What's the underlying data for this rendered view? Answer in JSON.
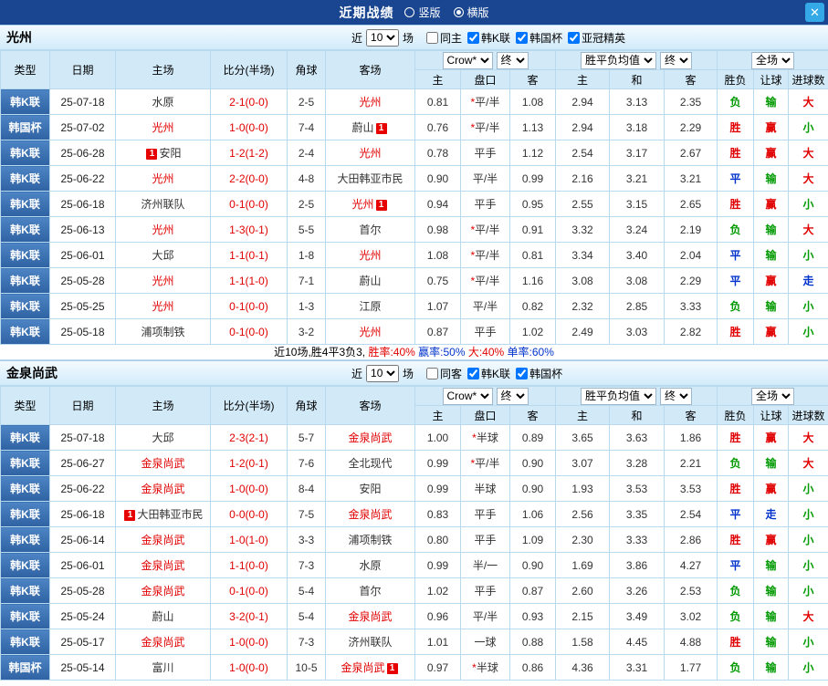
{
  "titlebar": {
    "title": "近期战绩",
    "view_options": [
      {
        "label": "竖版",
        "selected": false
      },
      {
        "label": "横版",
        "selected": true
      }
    ],
    "close_glyph": "✕"
  },
  "table_headers": {
    "type": "类型",
    "date": "日期",
    "home": "主场",
    "score": "比分(半场)",
    "corner": "角球",
    "away": "客场",
    "odds_source": "Crow*",
    "odds_final": "终",
    "europe_source": "胜平负均值",
    "europe_final": "终",
    "scope": "全场",
    "col_home": "主",
    "col_handicap": "盘口",
    "col_away": "客",
    "col_eu_home": "主",
    "col_eu_draw": "和",
    "col_eu_away": "客",
    "col_wdl": "胜负",
    "col_hc_result": "让球",
    "col_goals": "进球数"
  },
  "sections": [
    {
      "team": "光州",
      "filters": {
        "near_label": "近",
        "count": "10",
        "games_label": "场",
        "checkboxes": [
          {
            "label": "同主",
            "checked": false
          },
          {
            "label": "韩K联",
            "checked": true
          },
          {
            "label": "韩国杯",
            "checked": true
          },
          {
            "label": "亚冠精英",
            "checked": true
          }
        ]
      },
      "rows": [
        {
          "type": "韩K联",
          "date": "25-07-18",
          "home": {
            "name": "水原"
          },
          "score": "2-1(0-0)",
          "corner": "2-5",
          "away": {
            "name": "光州",
            "hl": true
          },
          "o1": "0.81",
          "hc": "*平/半",
          "o2": "1.08",
          "e1": "2.94",
          "e2": "3.13",
          "e3": "2.35",
          "r1": "负",
          "r2": "输",
          "r3": "大"
        },
        {
          "type": "韩国杯",
          "date": "25-07-02",
          "home": {
            "name": "光州",
            "hl": true
          },
          "score": "1-0(0-0)",
          "corner": "7-4",
          "away": {
            "name": "蔚山",
            "badge": "1",
            "badge_pos": "after"
          },
          "o1": "0.76",
          "hc": "*平/半",
          "o2": "1.13",
          "e1": "2.94",
          "e2": "3.18",
          "e3": "2.29",
          "r1": "胜",
          "r2": "赢",
          "r3": "小"
        },
        {
          "type": "韩K联",
          "date": "25-06-28",
          "home": {
            "name": "安阳",
            "badge": "1",
            "badge_pos": "before"
          },
          "score": "1-2(1-2)",
          "corner": "2-4",
          "away": {
            "name": "光州",
            "hl": true
          },
          "o1": "0.78",
          "hc": "平手",
          "o2": "1.12",
          "e1": "2.54",
          "e2": "3.17",
          "e3": "2.67",
          "r1": "胜",
          "r2": "赢",
          "r3": "大"
        },
        {
          "type": "韩K联",
          "date": "25-06-22",
          "home": {
            "name": "光州",
            "hl": true
          },
          "score": "2-2(0-0)",
          "corner": "4-8",
          "away": {
            "name": "大田韩亚市民"
          },
          "o1": "0.90",
          "hc": "平/半",
          "o2": "0.99",
          "e1": "2.16",
          "e2": "3.21",
          "e3": "3.21",
          "r1": "平",
          "r2": "输",
          "r3": "大"
        },
        {
          "type": "韩K联",
          "date": "25-06-18",
          "home": {
            "name": "济州联队"
          },
          "score": "0-1(0-0)",
          "corner": "2-5",
          "away": {
            "name": "光州",
            "hl": true,
            "badge": "1",
            "badge_pos": "after"
          },
          "o1": "0.94",
          "hc": "平手",
          "o2": "0.95",
          "e1": "2.55",
          "e2": "3.15",
          "e3": "2.65",
          "r1": "胜",
          "r2": "赢",
          "r3": "小"
        },
        {
          "type": "韩K联",
          "date": "25-06-13",
          "home": {
            "name": "光州",
            "hl": true
          },
          "score": "1-3(0-1)",
          "corner": "5-5",
          "away": {
            "name": "首尔"
          },
          "o1": "0.98",
          "hc": "*平/半",
          "o2": "0.91",
          "e1": "3.32",
          "e2": "3.24",
          "e3": "2.19",
          "r1": "负",
          "r2": "输",
          "r3": "大"
        },
        {
          "type": "韩K联",
          "date": "25-06-01",
          "home": {
            "name": "大邱"
          },
          "score": "1-1(0-1)",
          "corner": "1-8",
          "away": {
            "name": "光州",
            "hl": true
          },
          "o1": "1.08",
          "hc": "*平/半",
          "o2": "0.81",
          "e1": "3.34",
          "e2": "3.40",
          "e3": "2.04",
          "r1": "平",
          "r2": "输",
          "r3": "小"
        },
        {
          "type": "韩K联",
          "date": "25-05-28",
          "home": {
            "name": "光州",
            "hl": true
          },
          "score": "1-1(1-0)",
          "corner": "7-1",
          "away": {
            "name": "蔚山"
          },
          "o1": "0.75",
          "hc": "*平/半",
          "o2": "1.16",
          "e1": "3.08",
          "e2": "3.08",
          "e3": "2.29",
          "r1": "平",
          "r2": "赢",
          "r3": "走"
        },
        {
          "type": "韩K联",
          "date": "25-05-25",
          "home": {
            "name": "光州",
            "hl": true
          },
          "score": "0-1(0-0)",
          "corner": "1-3",
          "away": {
            "name": "江原"
          },
          "o1": "1.07",
          "hc": "平/半",
          "o2": "0.82",
          "e1": "2.32",
          "e2": "2.85",
          "e3": "3.33",
          "r1": "负",
          "r2": "输",
          "r3": "小"
        },
        {
          "type": "韩K联",
          "date": "25-05-18",
          "home": {
            "name": "浦项制铁"
          },
          "score": "0-1(0-0)",
          "corner": "3-2",
          "away": {
            "name": "光州",
            "hl": true
          },
          "o1": "0.87",
          "hc": "平手",
          "o2": "1.02",
          "e1": "2.49",
          "e2": "3.03",
          "e3": "2.82",
          "r1": "胜",
          "r2": "赢",
          "r3": "小"
        }
      ],
      "summary": [
        {
          "text": "近10场,胜4平3负3, ",
          "color": "black"
        },
        {
          "text": "胜率:40%",
          "color": "red"
        },
        {
          "text": " 赢率:50%",
          "color": "blue"
        },
        {
          "text": " 大:40%",
          "color": "red"
        },
        {
          "text": " 单率:60%",
          "color": "blue"
        }
      ]
    },
    {
      "team": "金泉尚武",
      "filters": {
        "near_label": "近",
        "count": "10",
        "games_label": "场",
        "checkboxes": [
          {
            "label": "同客",
            "checked": false
          },
          {
            "label": "韩K联",
            "checked": true
          },
          {
            "label": "韩国杯",
            "checked": true
          }
        ]
      },
      "rows": [
        {
          "type": "韩K联",
          "date": "25-07-18",
          "home": {
            "name": "大邱"
          },
          "score": "2-3(2-1)",
          "corner": "5-7",
          "away": {
            "name": "金泉尚武",
            "hl": true
          },
          "o1": "1.00",
          "hc": "*半球",
          "o2": "0.89",
          "e1": "3.65",
          "e2": "3.63",
          "e3": "1.86",
          "r1": "胜",
          "r2": "赢",
          "r3": "大"
        },
        {
          "type": "韩K联",
          "date": "25-06-27",
          "home": {
            "name": "金泉尚武",
            "hl": true
          },
          "score": "1-2(0-1)",
          "corner": "7-6",
          "away": {
            "name": "全北现代"
          },
          "o1": "0.99",
          "hc": "*平/半",
          "o2": "0.90",
          "e1": "3.07",
          "e2": "3.28",
          "e3": "2.21",
          "r1": "负",
          "r2": "输",
          "r3": "大"
        },
        {
          "type": "韩K联",
          "date": "25-06-22",
          "home": {
            "name": "金泉尚武",
            "hl": true
          },
          "score": "1-0(0-0)",
          "corner": "8-4",
          "away": {
            "name": "安阳"
          },
          "o1": "0.99",
          "hc": "半球",
          "o2": "0.90",
          "e1": "1.93",
          "e2": "3.53",
          "e3": "3.53",
          "r1": "胜",
          "r2": "赢",
          "r3": "小"
        },
        {
          "type": "韩K联",
          "date": "25-06-18",
          "home": {
            "name": "大田韩亚市民",
            "badge": "1",
            "badge_pos": "before"
          },
          "score": "0-0(0-0)",
          "corner": "7-5",
          "away": {
            "name": "金泉尚武",
            "hl": true
          },
          "o1": "0.83",
          "hc": "平手",
          "o2": "1.06",
          "e1": "2.56",
          "e2": "3.35",
          "e3": "2.54",
          "r1": "平",
          "r2": "走",
          "r3": "小"
        },
        {
          "type": "韩K联",
          "date": "25-06-14",
          "home": {
            "name": "金泉尚武",
            "hl": true
          },
          "score": "1-0(1-0)",
          "corner": "3-3",
          "away": {
            "name": "浦项制铁"
          },
          "o1": "0.80",
          "hc": "平手",
          "o2": "1.09",
          "e1": "2.30",
          "e2": "3.33",
          "e3": "2.86",
          "r1": "胜",
          "r2": "赢",
          "r3": "小"
        },
        {
          "type": "韩K联",
          "date": "25-06-01",
          "home": {
            "name": "金泉尚武",
            "hl": true
          },
          "score": "1-1(0-0)",
          "corner": "7-3",
          "away": {
            "name": "水原"
          },
          "o1": "0.99",
          "hc": "半/一",
          "o2": "0.90",
          "e1": "1.69",
          "e2": "3.86",
          "e3": "4.27",
          "r1": "平",
          "r2": "输",
          "r3": "小"
        },
        {
          "type": "韩K联",
          "date": "25-05-28",
          "home": {
            "name": "金泉尚武",
            "hl": true
          },
          "score": "0-1(0-0)",
          "corner": "5-4",
          "away": {
            "name": "首尔"
          },
          "o1": "1.02",
          "hc": "平手",
          "o2": "0.87",
          "e1": "2.60",
          "e2": "3.26",
          "e3": "2.53",
          "r1": "负",
          "r2": "输",
          "r3": "小"
        },
        {
          "type": "韩K联",
          "date": "25-05-24",
          "home": {
            "name": "蔚山"
          },
          "score": "3-2(0-1)",
          "corner": "5-4",
          "away": {
            "name": "金泉尚武",
            "hl": true
          },
          "o1": "0.96",
          "hc": "平/半",
          "o2": "0.93",
          "e1": "2.15",
          "e2": "3.49",
          "e3": "3.02",
          "r1": "负",
          "r2": "输",
          "r3": "大"
        },
        {
          "type": "韩K联",
          "date": "25-05-17",
          "home": {
            "name": "金泉尚武",
            "hl": true
          },
          "score": "1-0(0-0)",
          "corner": "7-3",
          "away": {
            "name": "济州联队"
          },
          "o1": "1.01",
          "hc": "一球",
          "o2": "0.88",
          "e1": "1.58",
          "e2": "4.45",
          "e3": "4.88",
          "r1": "胜",
          "r2": "输",
          "r3": "小"
        },
        {
          "type": "韩国杯",
          "date": "25-05-14",
          "home": {
            "name": "富川"
          },
          "score": "1-0(0-0)",
          "corner": "10-5",
          "away": {
            "name": "金泉尚武",
            "hl": true,
            "badge": "1",
            "badge_pos": "after"
          },
          "o1": "0.97",
          "hc": "*半球",
          "o2": "0.86",
          "e1": "4.36",
          "e2": "3.31",
          "e3": "1.77",
          "r1": "负",
          "r2": "输",
          "r3": "小"
        }
      ]
    }
  ]
}
